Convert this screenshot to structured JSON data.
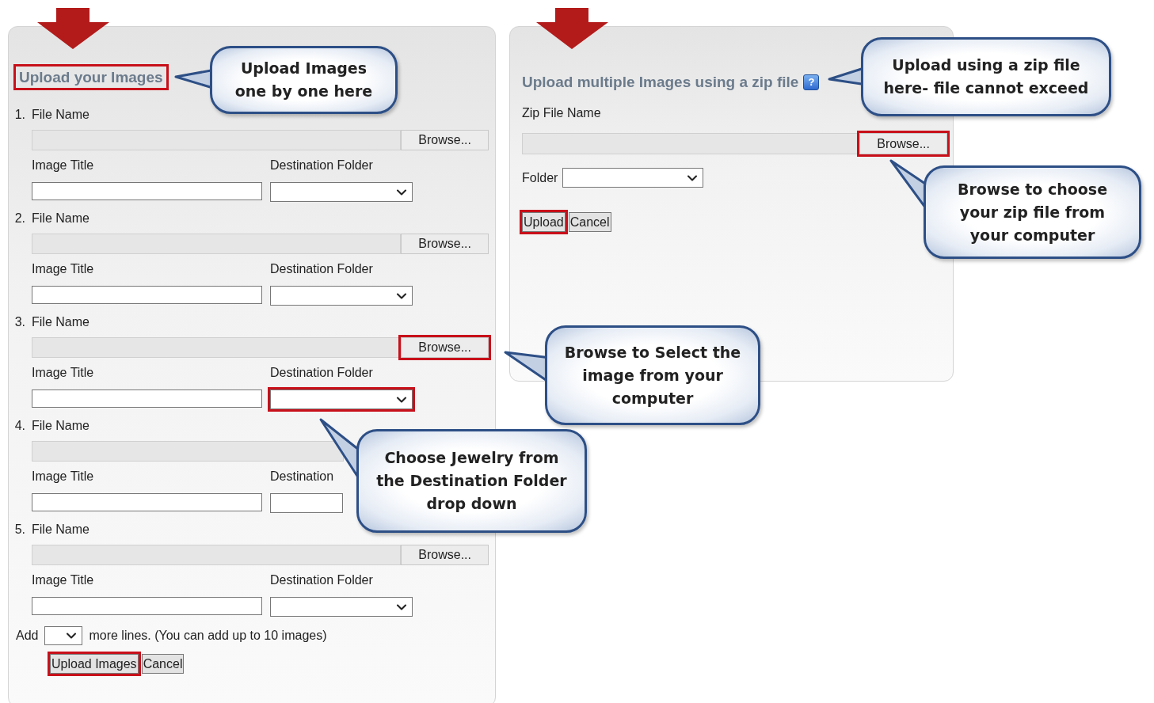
{
  "left_panel": {
    "title": {
      "text": "Upload your Images",
      "highlighted": true
    },
    "rows": [
      {
        "number": "1.",
        "file_label": "File Name",
        "browse": {
          "label": "Browse...",
          "highlighted": false
        },
        "title_label": "Image Title",
        "folder_label": "Destination Folder",
        "folder_highlighted": false
      },
      {
        "number": "2.",
        "file_label": "File Name",
        "browse": {
          "label": "Browse...",
          "highlighted": false
        },
        "title_label": "Image Title",
        "folder_label": "Destination Folder",
        "folder_highlighted": false
      },
      {
        "number": "3.",
        "file_label": "File Name",
        "browse": {
          "label": "Browse...",
          "highlighted": true
        },
        "title_label": "Image Title",
        "folder_label": "Destination Folder",
        "folder_highlighted": true
      },
      {
        "number": "4.",
        "file_label": "File Name",
        "title_label": "Image Title",
        "folder_label": "Destination",
        "folder_highlighted": false
      },
      {
        "number": "5.",
        "file_label": "File Name",
        "browse": {
          "label": "Browse...",
          "highlighted": false
        },
        "title_label": "Image Title",
        "folder_label": "Destination Folder",
        "folder_highlighted": false
      }
    ],
    "add_lines": {
      "prefix": "Add",
      "suffix": "more lines. (You can add up to 10 images)"
    },
    "buttons": [
      {
        "label": "Upload Images",
        "highlighted": true
      },
      {
        "label": "Cancel",
        "highlighted": false
      }
    ]
  },
  "right_panel": {
    "title": "Upload multiple Images using a zip file",
    "help_icon": "?",
    "zip_label": "Zip File Name",
    "browse": {
      "label": "Browse...",
      "highlighted": true
    },
    "folder_label": "Folder",
    "buttons": [
      {
        "label": "Upload",
        "highlighted": true
      },
      {
        "label": "Cancel",
        "highlighted": false
      }
    ]
  },
  "callouts": [
    {
      "lines": [
        "Upload Images",
        "one by one here"
      ]
    },
    {
      "lines": [
        "Upload using a zip file",
        "here- file cannot exceed"
      ]
    },
    {
      "lines": [
        "Browse to choose",
        "your zip file from",
        "your computer"
      ]
    },
    {
      "lines": [
        "Browse to Select the",
        "image from your",
        "computer"
      ]
    },
    {
      "lines": [
        "Choose Jewelry from",
        "the Destination Folder",
        "drop down"
      ]
    }
  ]
}
